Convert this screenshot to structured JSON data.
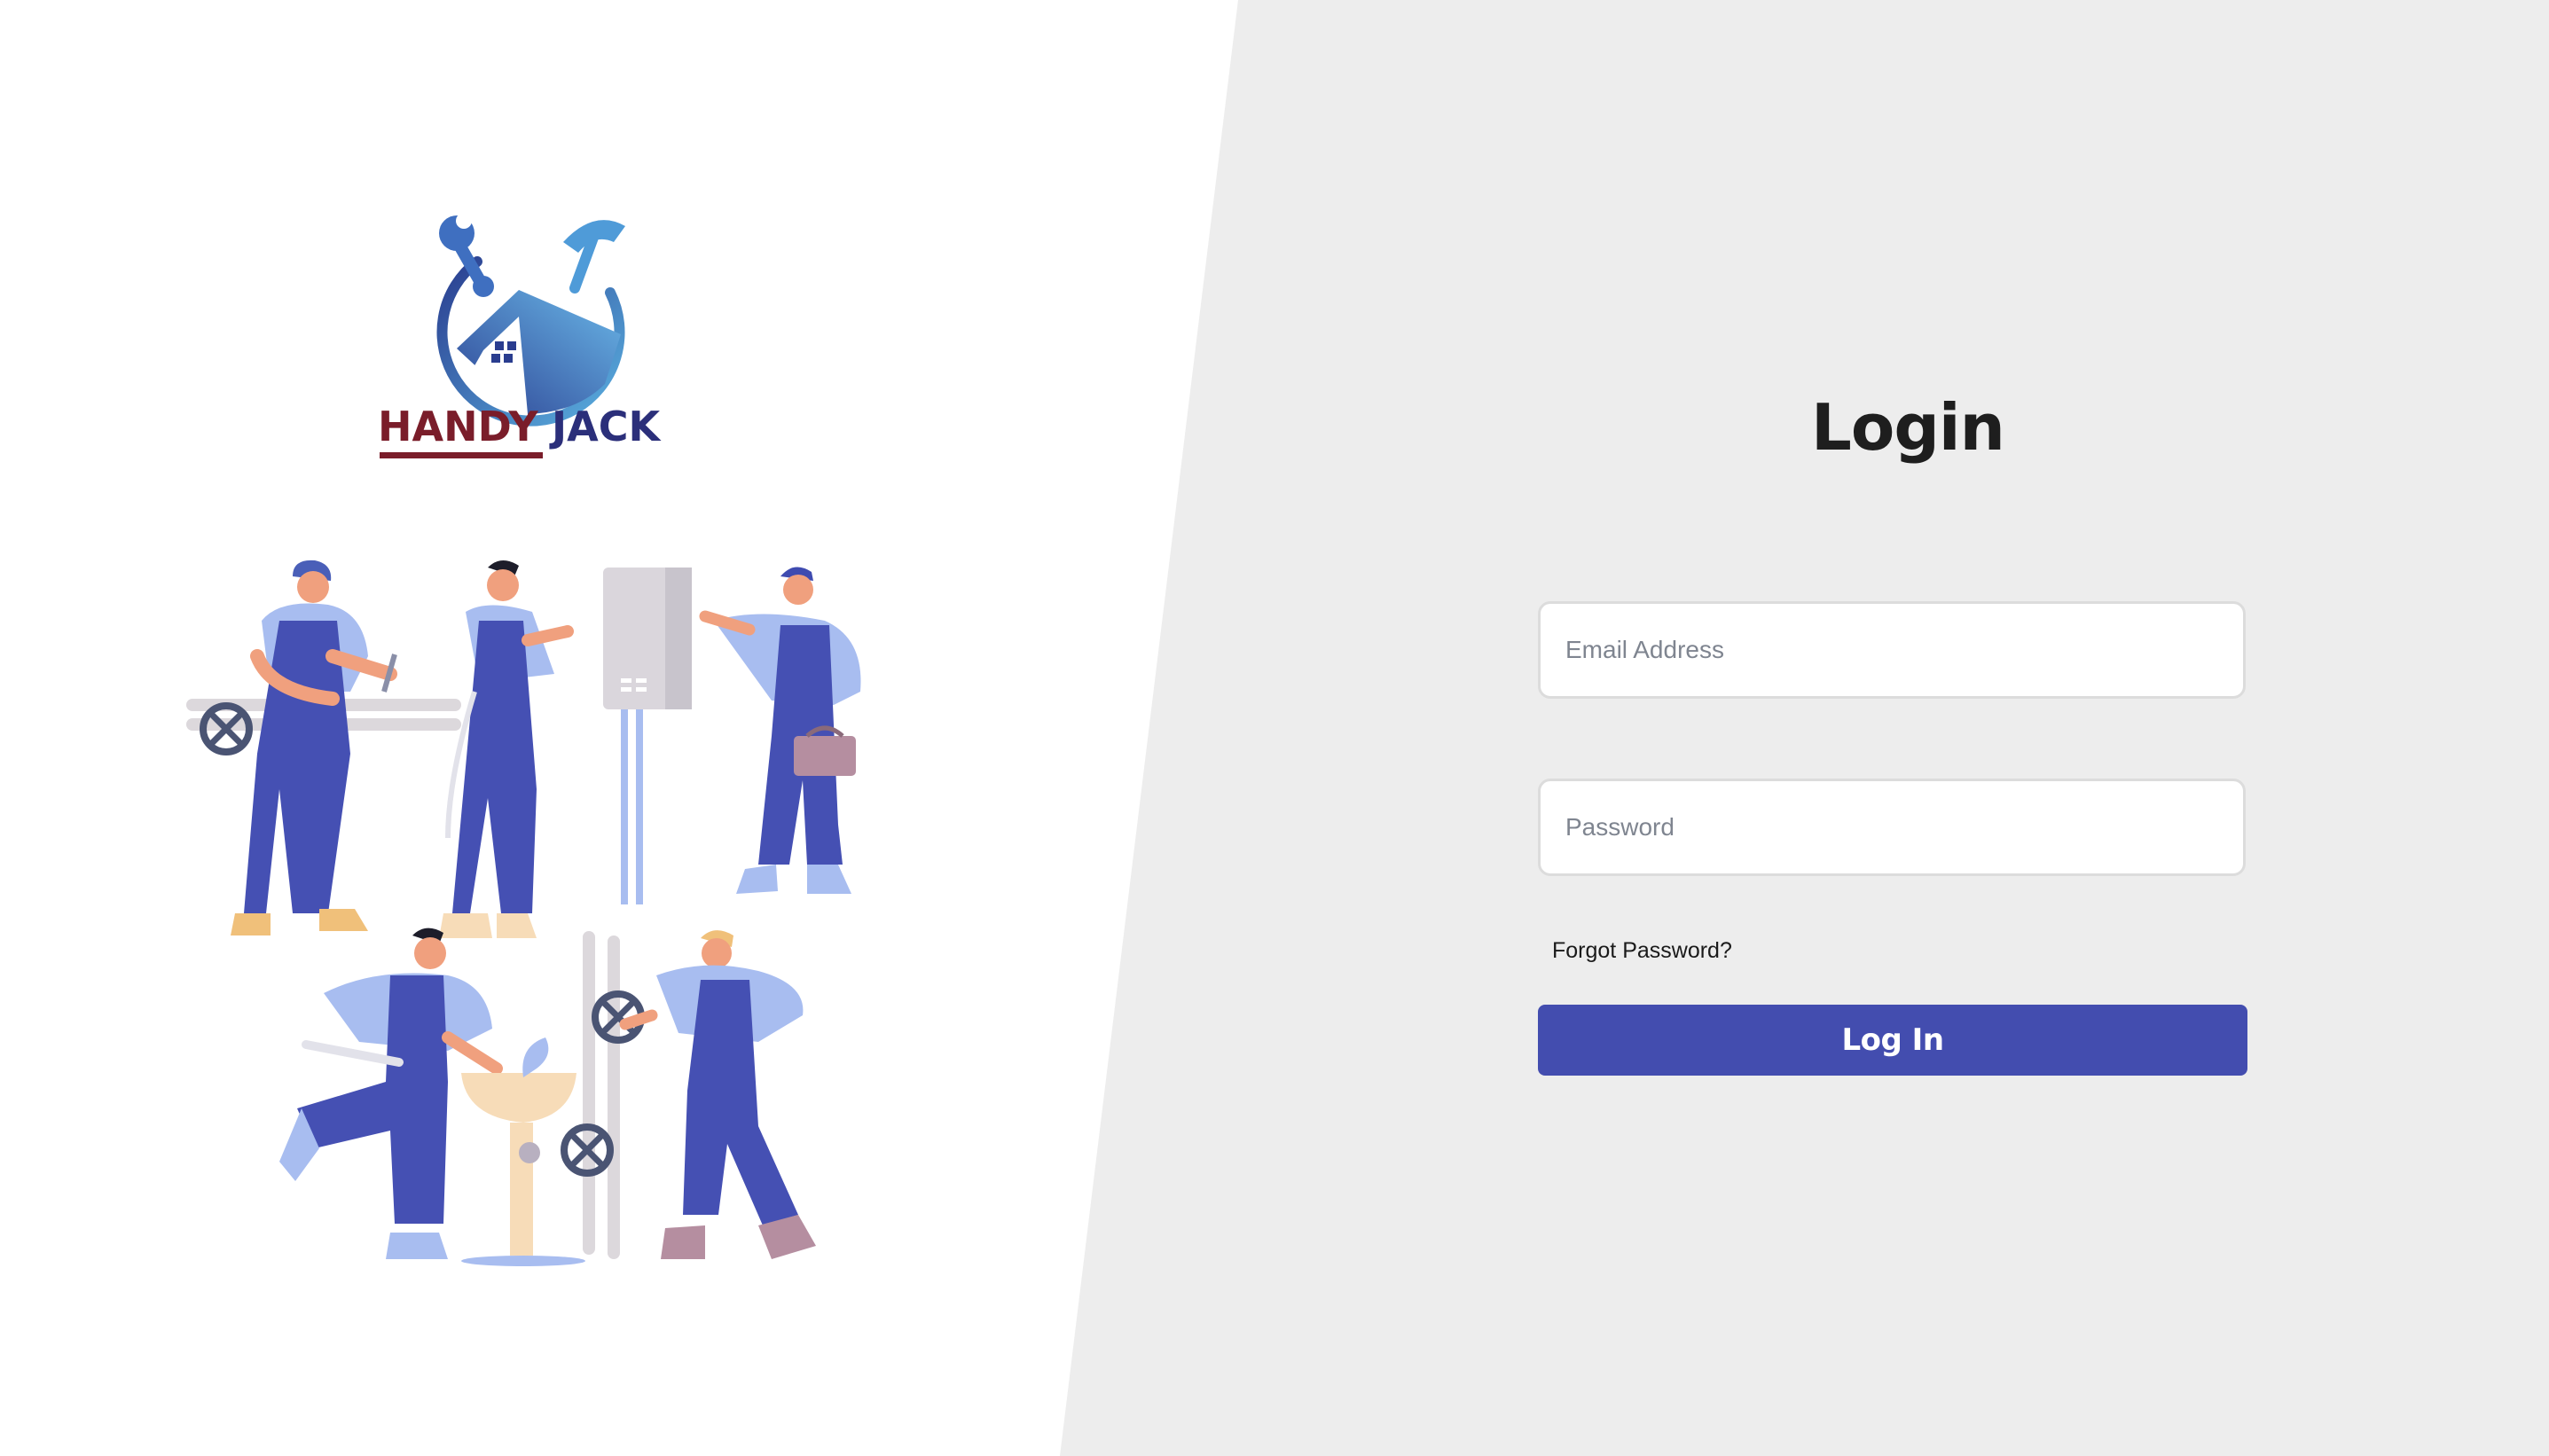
{
  "brand": {
    "word1": "HANDY",
    "word2": "JACK",
    "word1_color": "#7a1d2a",
    "word2_color": "#2b2f7a",
    "icon_names": [
      "wrench-icon",
      "hammer-icon",
      "house-icon"
    ]
  },
  "colors": {
    "left_background": "#ffffff",
    "right_background": "#ededed",
    "accent": "#434daf",
    "overall_blue": "#4550b3",
    "shirt_blue": "#a8bdf0"
  },
  "login": {
    "title": "Login",
    "email_placeholder": "Email Address",
    "password_placeholder": "Password",
    "forgot_label": "Forgot Password?",
    "submit_label": "Log In"
  }
}
